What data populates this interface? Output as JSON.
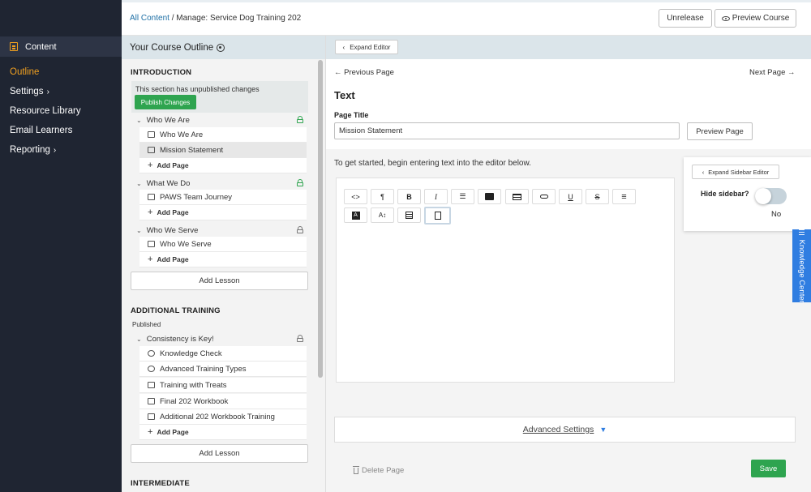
{
  "nav": {
    "content": "Content",
    "items": [
      {
        "label": "Outline",
        "chevron": ""
      },
      {
        "label": "Settings",
        "chevron": "›"
      },
      {
        "label": "Resource Library",
        "chevron": ""
      },
      {
        "label": "Email Learners",
        "chevron": ""
      },
      {
        "label": "Reporting",
        "chevron": "›"
      }
    ],
    "accent": "#f0a020"
  },
  "topbar": {
    "breadcrumb_link": "All Content",
    "breadcrumb_rest": "/ Manage: Service Dog Training 202",
    "unrelease": "Unrelease",
    "preview_course": "Preview Course"
  },
  "outline": {
    "header": "Your Course Outline",
    "introduction": {
      "title": "INTRODUCTION",
      "unpublished_note": "This section has unpublished changes",
      "publish_btn": "Publish Changes",
      "lessons": [
        {
          "title": "Who We Are",
          "pages": [
            "Who We Are",
            "Mission Statement"
          ],
          "add": "Add Page"
        },
        {
          "title": "What We Do",
          "pages": [
            "PAWS Team Journey"
          ],
          "add": "Add Page"
        },
        {
          "title": "Who We Serve",
          "pages": [
            "Who We Serve"
          ],
          "add": "Add Page"
        }
      ],
      "add_lesson": "Add Lesson"
    },
    "additional": {
      "title": "ADDITIONAL TRAINING",
      "status": "Published",
      "lesson": "Consistency is Key!",
      "pages": [
        "Knowledge Check",
        "Advanced Training Types",
        "Training with Treats",
        "Final 202 Workbook",
        "Additional 202 Workbook Training"
      ],
      "add": "Add Page",
      "add_lesson": "Add Lesson"
    },
    "intermediate": {
      "title": "INTERMEDIATE"
    }
  },
  "editor": {
    "expand_editor": "Expand Editor",
    "prev_page": "Previous Page",
    "next_page": "Next Page",
    "section_title": "Text",
    "page_title_label": "Page Title",
    "page_title_value": "Mission Statement",
    "preview_page": "Preview Page",
    "get_started": "To get started, begin entering text into the editor below.",
    "toolbar": {
      "code": "<>",
      "paragraph": "¶",
      "bold": "B",
      "italic": "I",
      "bullets": "☰",
      "underline": "U",
      "strike": "S",
      "align": "≡",
      "fontsize": "A↕"
    },
    "advanced": "Advanced Settings",
    "delete_page": "Delete Page",
    "save": "Save"
  },
  "sidebar_editor": {
    "expand": "Expand Sidebar Editor",
    "hide_label": "Hide sidebar?",
    "toggle_value": "No"
  },
  "knowledge_center": "Knowledge Center"
}
